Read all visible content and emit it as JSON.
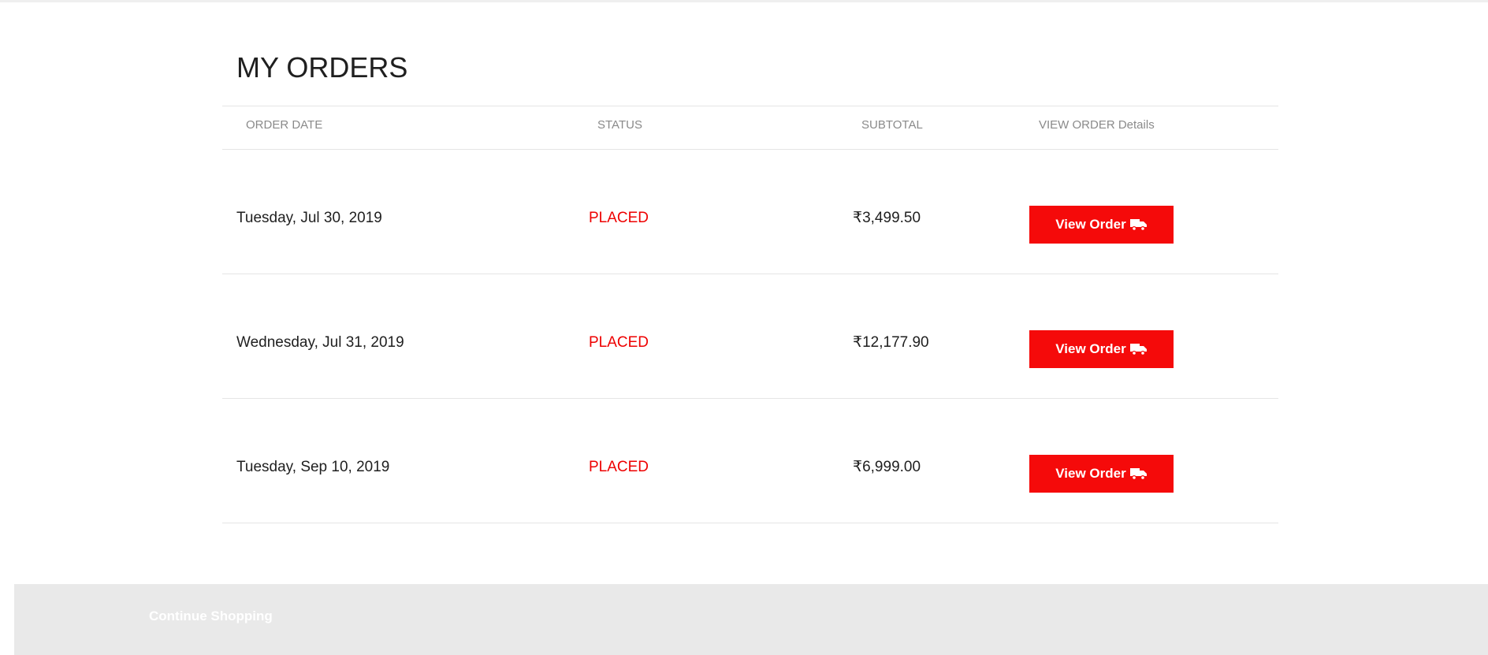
{
  "page": {
    "title": "MY ORDERS"
  },
  "table": {
    "headers": {
      "order_date": "ORDER DATE",
      "status": "STATUS",
      "subtotal": "SUBTOTAL",
      "view": "VIEW ORDER Details"
    },
    "rows": [
      {
        "date": "Tuesday, Jul 30, 2019",
        "status": "PLACED",
        "subtotal": "₹3,499.50",
        "button": "View Order"
      },
      {
        "date": "Wednesday, Jul 31, 2019",
        "status": "PLACED",
        "subtotal": "₹12,177.90",
        "button": "View Order"
      },
      {
        "date": "Tuesday, Sep 10, 2019",
        "status": "PLACED",
        "subtotal": "₹6,999.00",
        "button": "View Order"
      }
    ]
  },
  "footer": {
    "continue_label": "Continue Shopping"
  },
  "icons": {
    "view_order": "truck-icon"
  },
  "colors": {
    "accent": "#f50a0a",
    "status_placed": "#ee0000",
    "footer_bg": "#e9e9e9"
  }
}
